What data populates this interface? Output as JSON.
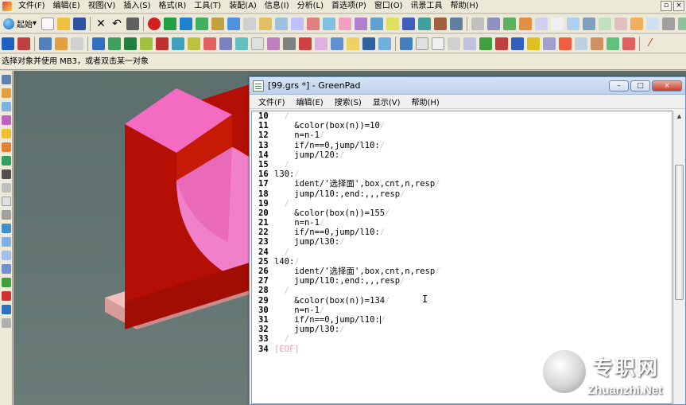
{
  "app": {
    "menu": [
      "文件(F)",
      "编辑(E)",
      "视图(V)",
      "插入(S)",
      "格式(R)",
      "工具(T)",
      "装配(A)",
      "信息(I)",
      "分析(L)",
      "首选项(P)",
      "窗口(O)",
      "讯景工具",
      "帮助(H)"
    ],
    "start_label": "起始",
    "prompt": "选择对象并使用 MB3，或者双击某一对象"
  },
  "greenpad": {
    "title": "[99.grs *] - GreenPad",
    "menu": [
      "文件(F)",
      "编辑(E)",
      "搜索(S)",
      "显示(V)",
      "帮助(H)"
    ],
    "lines": [
      {
        "n": "10",
        "text": ""
      },
      {
        "n": "11",
        "text": "&color(box(n))=10"
      },
      {
        "n": "12",
        "text": "n=n-1"
      },
      {
        "n": "13",
        "text": "if/n==0,jump/l10:"
      },
      {
        "n": "14",
        "text": "jump/l20:"
      },
      {
        "n": "15",
        "text": ""
      },
      {
        "n": "16",
        "text": "l30:"
      },
      {
        "n": "17",
        "text": "ident/'选择面',box,cnt,n,resp"
      },
      {
        "n": "18",
        "text": "jump/l10:,end:,,,resp"
      },
      {
        "n": "19",
        "text": ""
      },
      {
        "n": "20",
        "text": "&color(box(n))=155"
      },
      {
        "n": "21",
        "text": "n=n-1"
      },
      {
        "n": "22",
        "text": "if/n==0,jump/l10:"
      },
      {
        "n": "23",
        "text": "jump/l30:"
      },
      {
        "n": "24",
        "text": ""
      },
      {
        "n": "25",
        "text": "l40:"
      },
      {
        "n": "26",
        "text": "ident/'选择面',box,cnt,n,resp"
      },
      {
        "n": "27",
        "text": "jump/l10:,end:,,,resp"
      },
      {
        "n": "28",
        "text": ""
      },
      {
        "n": "29",
        "text": "&color(box(n))=134"
      },
      {
        "n": "30",
        "text": "n=n-1"
      },
      {
        "n": "31",
        "text": "if/n==0,jump/l10:"
      },
      {
        "n": "32",
        "text": "jump/l30:"
      },
      {
        "n": "33",
        "text": ""
      },
      {
        "n": "34",
        "text": "[EOF]"
      }
    ]
  },
  "watermark": {
    "cn": "专职网",
    "en": "Zhuanzhi.Net"
  }
}
